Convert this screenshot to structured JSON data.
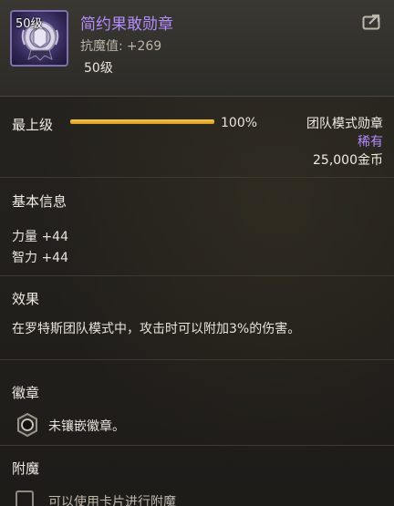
{
  "item": {
    "level_badge": "50级",
    "name": "简约果敢勋章",
    "stat_label": "抗魔值:",
    "stat_value": "+269",
    "required_level": "50级"
  },
  "upgrade": {
    "label": "最上级",
    "progress": 1.0,
    "percent_text": "100%"
  },
  "meta": {
    "type": "团队模式勋章",
    "rarity": "稀有",
    "price": "25,000金币"
  },
  "basic_info": {
    "title": "基本信息",
    "stats": [
      "力量 +44",
      "智力 +44"
    ]
  },
  "effect": {
    "title": "效果",
    "text": "在罗特斯团队模式中，攻击时可以附加3%的伤害。"
  },
  "emblem": {
    "title": "徽章",
    "slot_text": "未镶嵌徽章。"
  },
  "enchant": {
    "title": "附魔",
    "text": "可以使用卡片进行附魔"
  },
  "colors": {
    "item_name": "#b48cff",
    "rarity": "#b48cff",
    "progress_fill": "#f0b83a",
    "background": "#23211d"
  },
  "icons": {
    "item": "medal-icon",
    "share": "share-icon",
    "socket": "emblem-socket-icon",
    "enchant": "enchant-slot-icon"
  }
}
